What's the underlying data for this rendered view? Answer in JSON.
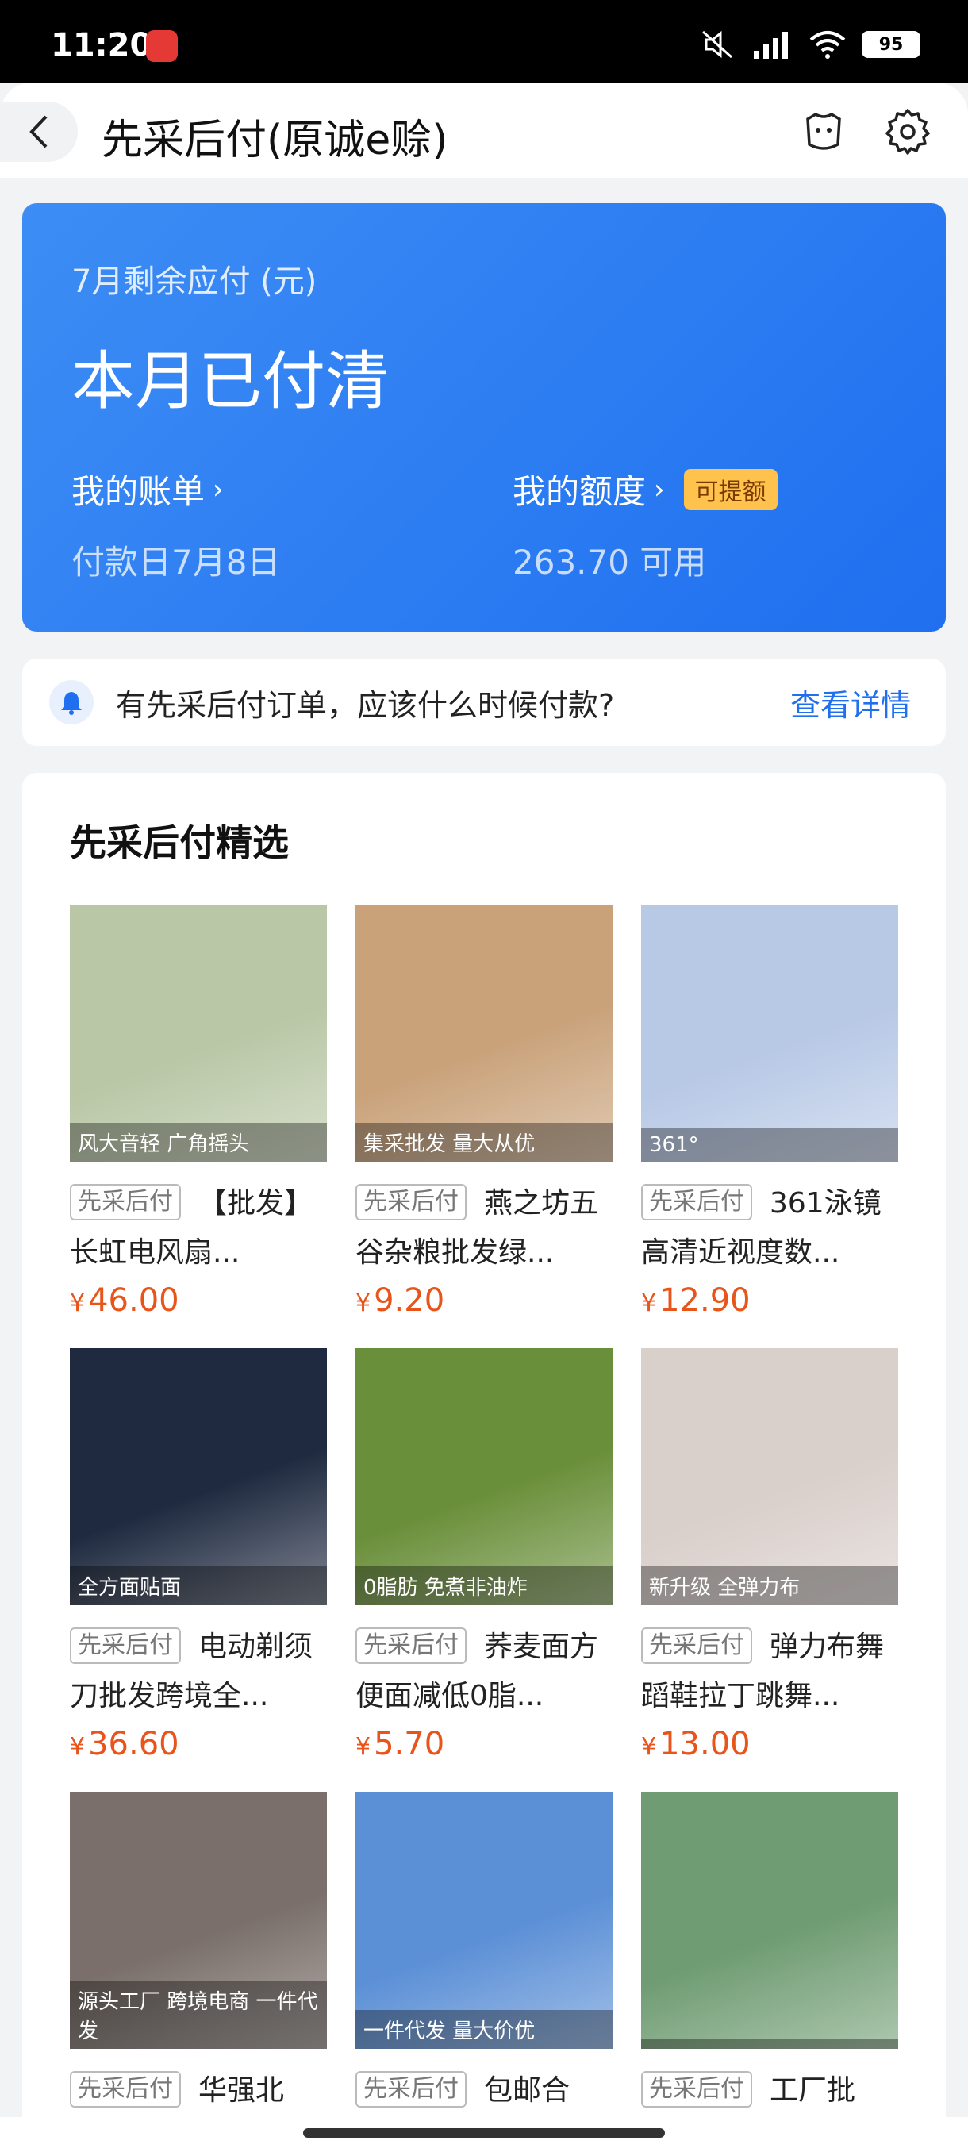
{
  "status_bar": {
    "time": "11:20",
    "battery": "95"
  },
  "header": {
    "title": "先采后付(原诚e赊)"
  },
  "card": {
    "subtitle": "7月剩余应付 (元)",
    "headline": "本月已付清",
    "bill_link": "我的账单",
    "bill_value": "付款日7月8日",
    "quota_link": "我的额度",
    "quota_badge": "可提额",
    "quota_value": "263.70 可用"
  },
  "notice": {
    "text": "有先采后付订单，应该什么时候付款?",
    "link": "查看详情"
  },
  "section": {
    "title": "先采后付精选"
  },
  "products": [
    {
      "tag": "先采后付",
      "title": "【批发】长虹电风扇...",
      "price": "46.00",
      "image_label": "风大音轻 广角摇头",
      "color": "#b9c7a6"
    },
    {
      "tag": "先采后付",
      "title": "燕之坊五谷杂粮批发绿...",
      "price": "9.20",
      "image_label": "集采批发 量大从优",
      "color": "#c9a27a"
    },
    {
      "tag": "先采后付",
      "title": "361泳镜高清近视度数...",
      "price": "12.90",
      "image_label": "361°",
      "color": "#b8c9e6"
    },
    {
      "tag": "先采后付",
      "title": "电动剃须刀批发跨境全...",
      "price": "36.60",
      "image_label": "全方面贴面",
      "color": "#1f2a40"
    },
    {
      "tag": "先采后付",
      "title": "荞麦面方便面减低0脂...",
      "price": "5.70",
      "image_label": "0脂肪 免煮非油炸",
      "color": "#6a8f3a"
    },
    {
      "tag": "先采后付",
      "title": "弹力布舞蹈鞋拉丁跳舞...",
      "price": "13.00",
      "image_label": "新升级 全弹力布",
      "color": "#d9cfcb"
    },
    {
      "tag": "先采后付",
      "title": "华强北",
      "price": "",
      "image_label": "源头工厂 跨境电商 一件代发",
      "color": "#7a6f6a"
    },
    {
      "tag": "先采后付",
      "title": "包邮合",
      "price": "",
      "image_label": "一件代发 量大价优",
      "color": "#5b8fd6"
    },
    {
      "tag": "先采后付",
      "title": "工厂批",
      "price": "",
      "image_label": "",
      "color": "#6f9c72"
    }
  ]
}
